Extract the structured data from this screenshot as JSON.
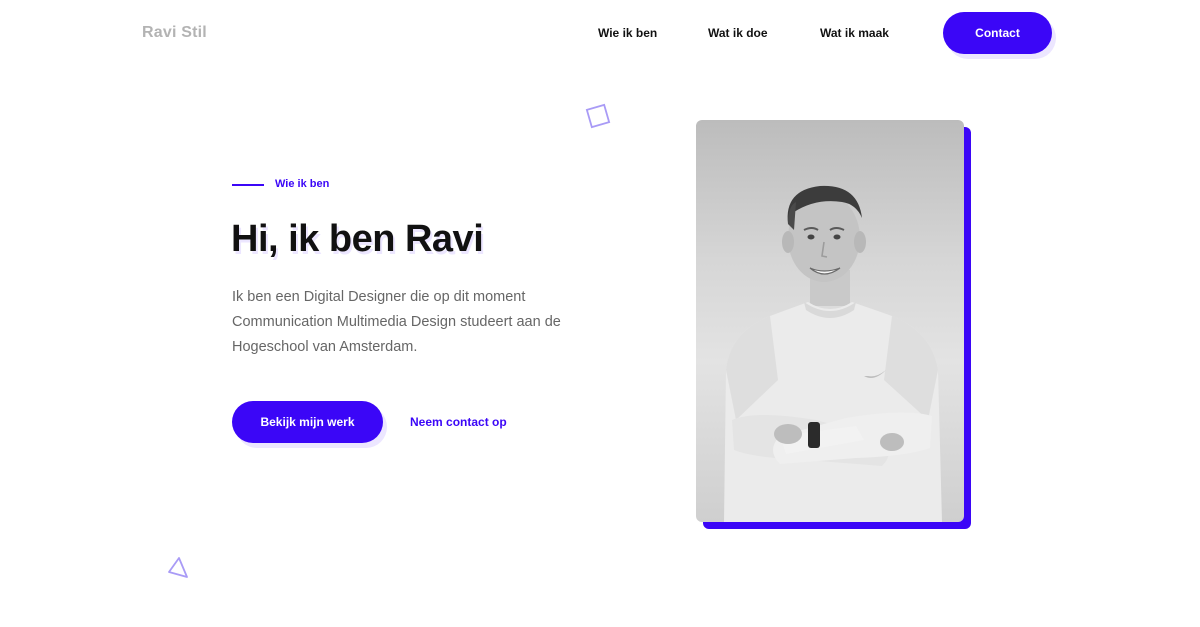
{
  "header": {
    "logo": "Ravi Stil",
    "nav": [
      {
        "label": "Wie ik ben"
      },
      {
        "label": "Wat ik doe"
      },
      {
        "label": "Wat ik maak"
      }
    ],
    "contact_label": "Contact"
  },
  "hero": {
    "eyebrow": "Wie ik ben",
    "title": "Hi, ik ben Ravi",
    "text": "Ik ben een Digital Designer die op dit moment Communication Multimedia Design studeert aan de Hogeschool van Amsterdam.",
    "primary_button": "Bekijk mijn werk",
    "secondary_link": "Neem contact op"
  },
  "photo": {
    "subject": "black-and-white portrait of a young man with arms crossed"
  },
  "colors": {
    "accent": "#3b06f7",
    "accent_soft": "#ece6ff",
    "logo": "#b3b3b3",
    "body_text": "#666666"
  },
  "icons": [
    "square-outline-icon",
    "triangle-outline-icon"
  ]
}
